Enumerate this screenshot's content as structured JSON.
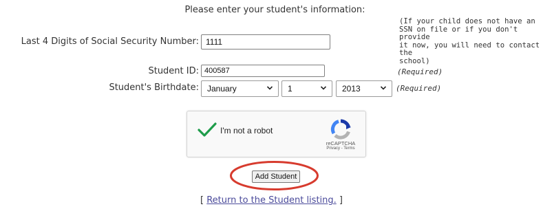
{
  "form": {
    "heading": "Please enter your student's information:",
    "ssn": {
      "label": "Last 4 Digits of Social Security Number:",
      "value": "1111",
      "note_lines": [
        "(If your child does not have an",
        "SSN on file or if you don't provide",
        "it now, you will need to contact the",
        "school)"
      ]
    },
    "student_id": {
      "label": "Student ID:",
      "value": "400587",
      "note": "(Required)"
    },
    "birthdate": {
      "label": "Student's Birthdate:",
      "month": "January",
      "day": "1",
      "year": "2013",
      "note": "(Required)"
    }
  },
  "captcha": {
    "label": "I'm not a robot",
    "brand": "reCAPTCHA",
    "links": "Privacy - Terms",
    "check_color": "#1e9c4a",
    "logo_colors": [
      "#1c3aa9",
      "#4285f4",
      "#b3b3b3"
    ]
  },
  "actions": {
    "add_student_label": "Add Student",
    "highlight_color": "#d73b2e"
  },
  "footer": {
    "open_bracket": "[",
    "link_text": "Return to the Student listing.",
    "close_bracket": "]"
  }
}
